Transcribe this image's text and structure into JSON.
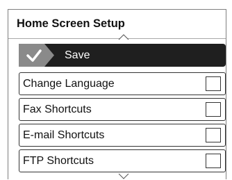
{
  "header": {
    "title": "Home Screen Setup"
  },
  "save_button": {
    "label": "Save",
    "icon": "check-icon"
  },
  "items": [
    {
      "label": "Change Language",
      "checked": false
    },
    {
      "label": "Fax Shortcuts",
      "checked": false
    },
    {
      "label": "E-mail Shortcuts",
      "checked": false
    },
    {
      "label": "FTP Shortcuts",
      "checked": false
    }
  ],
  "scroll_indicators": {
    "up": "chevron-up-icon",
    "down": "chevron-down-icon"
  },
  "colors": {
    "save_background": "#1f1f1f",
    "check_arrow": "#8a8a8a",
    "border": "#333333"
  }
}
